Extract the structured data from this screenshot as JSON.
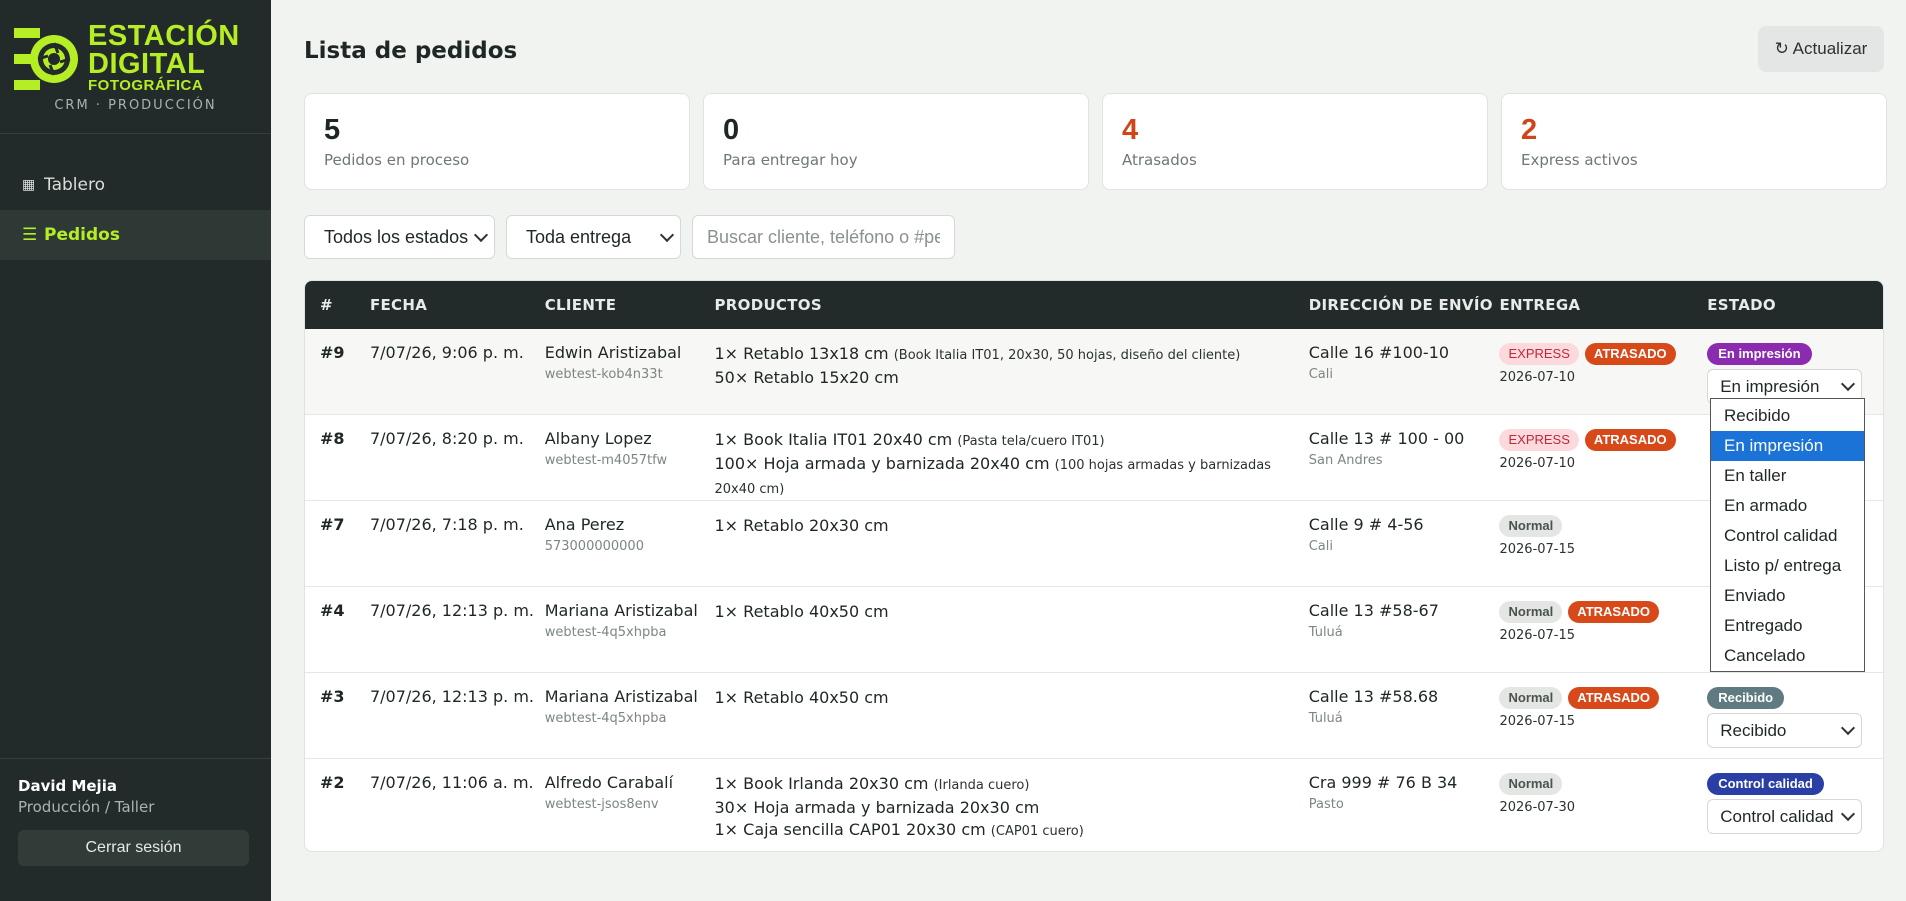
{
  "brand": {
    "line1": "ESTACIÓN",
    "line2": "DIGITAL",
    "line3": "FOTOGRÁFICA",
    "subtitle": "CRM · PRODUCCIÓN",
    "accent_color": "#b5ee25"
  },
  "sidebar": {
    "items": [
      {
        "icon": "grid-icon",
        "glyph": "▦",
        "label": "Tablero"
      },
      {
        "icon": "list-icon",
        "glyph": "☰",
        "label": "Pedidos",
        "active": true
      }
    ],
    "user": {
      "name": "David Mejia",
      "role": "Producción / Taller"
    },
    "logout_label": "Cerrar sesión"
  },
  "header": {
    "title": "Lista de pedidos",
    "refresh_label": "↻ Actualizar"
  },
  "stats": [
    {
      "value": "5",
      "label": "Pedidos en proceso"
    },
    {
      "value": "0",
      "label": "Para entregar hoy"
    },
    {
      "value": "4",
      "label": "Atrasados"
    },
    {
      "value": "2",
      "label": "Express activos"
    }
  ],
  "filters": {
    "status_select": "Todos los estados",
    "delivery_select": "Toda entrega",
    "search_placeholder": "Buscar cliente, teléfono o #ped"
  },
  "table": {
    "columns": [
      "#",
      "FECHA",
      "CLIENTE",
      "PRODUCTOS",
      "DIRECCIÓN DE ENVÍO",
      "ENTREGA",
      "ESTADO"
    ],
    "rows": [
      {
        "num": "#9",
        "date": "7/07/26, 9:06 p. m.",
        "client": "Edwin Aristizabal",
        "client_id": "webtest-kob4n33t",
        "products": [
          {
            "text": "1× Retablo 13x18 cm",
            "note": "(Book Italia IT01, 20x30, 50 hojas, diseño del cliente)"
          },
          {
            "text": "50× Retablo 15x20 cm",
            "note": ""
          }
        ],
        "address": "Calle 16 #100-10",
        "city": "Cali",
        "type_badge": "EXPRESS",
        "late_badge": "ATRASADO",
        "delivery_date": "2026-07-10",
        "status_badge": "En impresión",
        "status_color": "#8a2bb0",
        "status_select": "En impresión"
      },
      {
        "num": "#8",
        "date": "7/07/26, 8:20 p. m.",
        "client": "Albany Lopez",
        "client_id": "webtest-m4057tfw",
        "products": [
          {
            "text": "1× Book Italia IT01 20x40 cm",
            "note": "(Pasta tela/cuero IT01)"
          },
          {
            "text": "100× Hoja armada y barnizada 20x40 cm",
            "note": "(100 hojas armadas y barnizadas 20x40 cm)"
          }
        ],
        "address": "Calle 13 # 100 - 00",
        "city": "San Andres",
        "type_badge": "EXPRESS",
        "late_badge": "ATRASADO",
        "delivery_date": "2026-07-10"
      },
      {
        "num": "#7",
        "date": "7/07/26, 7:18 p. m.",
        "client": "Ana Perez",
        "client_id": "573000000000",
        "products": [
          {
            "text": "1× Retablo 20x30 cm",
            "note": ""
          }
        ],
        "address": "Calle 9 # 4-56",
        "city": "Cali",
        "type_badge": "Normal",
        "late_badge": "",
        "delivery_date": "2026-07-15"
      },
      {
        "num": "#4",
        "date": "7/07/26, 12:13 p. m.",
        "client": "Mariana Aristizabal",
        "client_id": "webtest-4q5xhpba",
        "products": [
          {
            "text": "1× Retablo 40x50 cm",
            "note": ""
          }
        ],
        "address": "Calle 13 #58-67",
        "city": "Tuluá",
        "type_badge": "Normal",
        "late_badge": "ATRASADO",
        "delivery_date": "2026-07-15"
      },
      {
        "num": "#3",
        "date": "7/07/26, 12:13 p. m.",
        "client": "Mariana Aristizabal",
        "client_id": "webtest-4q5xhpba",
        "products": [
          {
            "text": "1× Retablo 40x50 cm",
            "note": ""
          }
        ],
        "address": "Calle 13 #58.68",
        "city": "Tuluá",
        "type_badge": "Normal",
        "late_badge": "ATRASADO",
        "delivery_date": "2026-07-15",
        "status_badge": "Recibido",
        "status_color": "#5f7a80",
        "status_select": "Recibido"
      },
      {
        "num": "#2",
        "date": "7/07/26, 11:06 a. m.",
        "client": "Alfredo Carabalí",
        "client_id": "webtest-jsos8env",
        "products": [
          {
            "text": "1× Book Irlanda 20x30 cm",
            "note": "(Irlanda cuero)"
          },
          {
            "text": "30× Hoja armada y barnizada 20x30 cm",
            "note": ""
          },
          {
            "text": "1× Caja sencilla CAP01 20x30 cm",
            "note": "(CAP01 cuero)"
          }
        ],
        "address": "Cra 999 # 76 B 34",
        "city": "Pasto",
        "type_badge": "Normal",
        "late_badge": "",
        "delivery_date": "2026-07-30",
        "status_badge": "Control calidad",
        "status_color": "#2a3fa6",
        "status_select": "Control calidad"
      }
    ]
  },
  "status_dropdown": {
    "options": [
      "Recibido",
      "En impresión",
      "En taller",
      "En armado",
      "Control calidad",
      "Listo p/ entrega",
      "Enviado",
      "Entregado",
      "Cancelado"
    ],
    "selected": "En impresión"
  }
}
